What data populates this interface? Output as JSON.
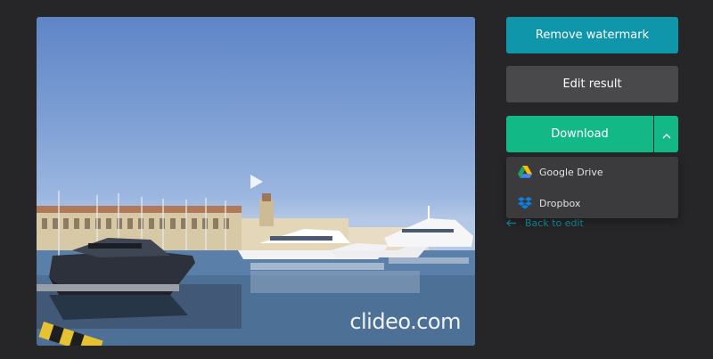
{
  "preview": {
    "watermark": "clideo.com"
  },
  "actions": {
    "remove_watermark_label": "Remove watermark",
    "edit_result_label": "Edit result",
    "download_label": "Download"
  },
  "download_menu": {
    "items": [
      {
        "label": "Google Drive",
        "icon": "google-drive-icon"
      },
      {
        "label": "Dropbox",
        "icon": "dropbox-icon"
      }
    ]
  },
  "back_link": {
    "label": "Back to edit",
    "icon": "arrow-left-icon"
  },
  "colors": {
    "background": "#262628",
    "remove_watermark": "#0f96aa",
    "edit_result": "#49494b",
    "download": "#12b886",
    "menu_bg": "#3b3b3d",
    "link": "#127e8e"
  }
}
